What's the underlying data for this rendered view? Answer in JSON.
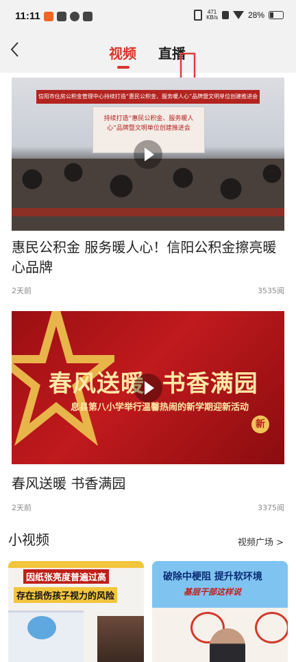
{
  "status_bar": {
    "time": "11:11",
    "net_speed_value": "471",
    "net_speed_unit": "KB/s",
    "battery": "28%"
  },
  "nav": {
    "tabs": [
      {
        "label": "视频",
        "active": true
      },
      {
        "label": "直播",
        "active": false
      }
    ]
  },
  "videos": [
    {
      "title": "惠民公积金 服务暖人心！信阳公积金擦亮暖心品牌",
      "time_ago": "2天前",
      "views": "3535阅",
      "banner_text": "信阳市住房公积金管理中心持续打造“惠民公积金、服务暖人心”品牌暨文明单位创建推进会",
      "screen_text": "持续打造“惠民公积金、服务暖人心”品牌暨文明单位创建推进会"
    },
    {
      "title": "春风送暖 书香满园",
      "time_ago": "2天前",
      "views": "3375阅",
      "thumb_heading": "春风送暖  书香满园",
      "thumb_sub": "息县第八小学举行温馨热闹的新学期迎新活动",
      "badge": "新"
    }
  ],
  "short_videos_section": {
    "title": "小视频",
    "more_label": "视频广场 >",
    "items": [
      {
        "line1": "因纸张亮度普遍过高",
        "line2": "存在损伤孩子视力的风险"
      },
      {
        "line1": "破除中梗阻  提升软环境",
        "line2": "基层干部这样说"
      }
    ]
  },
  "colors": {
    "accent": "#d9342b",
    "status_bg": "#f2f2f2"
  }
}
